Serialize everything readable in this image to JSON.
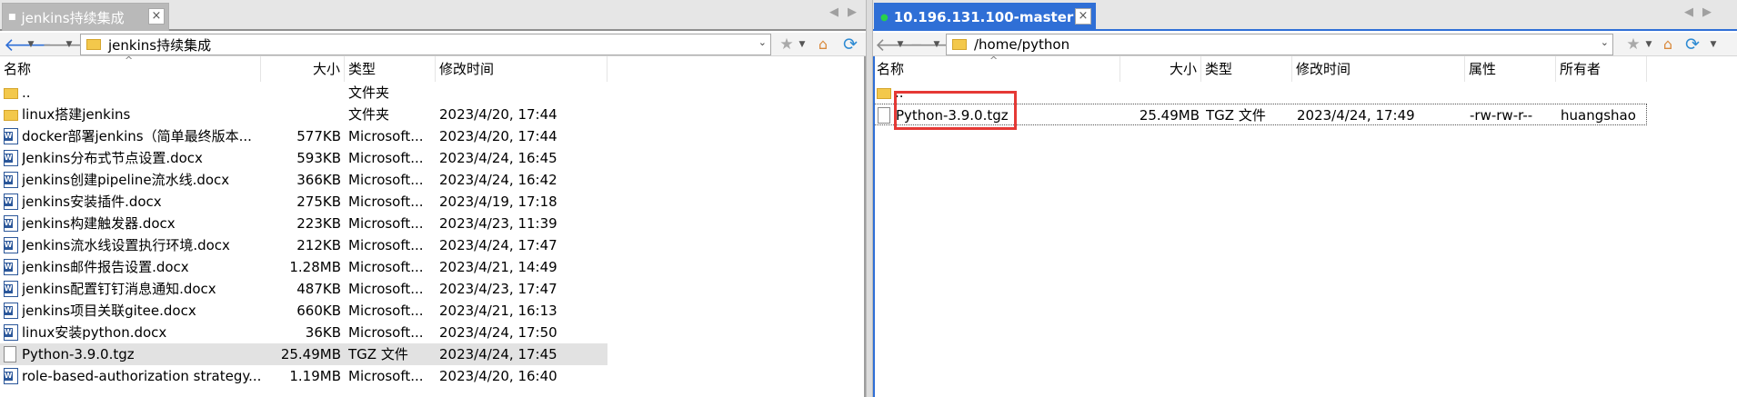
{
  "left": {
    "tab_title": "jenkins持续集成",
    "tab_state_icon": "square-icon",
    "close_glyph": "×",
    "path": "jenkins持续集成",
    "columns": {
      "name": "名称",
      "size": "大小",
      "type": "类型",
      "mtime": "修改时间"
    },
    "files": [
      {
        "icon": "folder",
        "name": "..",
        "size": "",
        "type": "文件夹",
        "mtime": ""
      },
      {
        "icon": "folder",
        "name": "linux搭建jenkins",
        "size": "",
        "type": "文件夹",
        "mtime": "2023/4/20, 17:44"
      },
      {
        "icon": "doc",
        "name": "docker部署jenkins（简单最终版本...",
        "size": "577KB",
        "type": "Microsoft...",
        "mtime": "2023/4/20, 17:44"
      },
      {
        "icon": "doc",
        "name": "Jenkins分布式节点设置.docx",
        "size": "593KB",
        "type": "Microsoft...",
        "mtime": "2023/4/24, 16:45"
      },
      {
        "icon": "doc",
        "name": "jenkins创建pipeline流水线.docx",
        "size": "366KB",
        "type": "Microsoft...",
        "mtime": "2023/4/24, 16:42"
      },
      {
        "icon": "doc",
        "name": "jenkins安装插件.docx",
        "size": "275KB",
        "type": "Microsoft...",
        "mtime": "2023/4/19, 17:18"
      },
      {
        "icon": "doc",
        "name": "jenkins构建触发器.docx",
        "size": "223KB",
        "type": "Microsoft...",
        "mtime": "2023/4/23, 11:39"
      },
      {
        "icon": "doc",
        "name": "Jenkins流水线设置执行环境.docx",
        "size": "212KB",
        "type": "Microsoft...",
        "mtime": "2023/4/24, 17:47"
      },
      {
        "icon": "doc",
        "name": "jenkins邮件报告设置.docx",
        "size": "1.28MB",
        "type": "Microsoft...",
        "mtime": "2023/4/21, 14:49"
      },
      {
        "icon": "doc",
        "name": "jenkins配置钉钉消息通知.docx",
        "size": "487KB",
        "type": "Microsoft...",
        "mtime": "2023/4/23, 17:47"
      },
      {
        "icon": "doc",
        "name": "jenkins项目关联gitee.docx",
        "size": "660KB",
        "type": "Microsoft...",
        "mtime": "2023/4/21, 16:13"
      },
      {
        "icon": "doc",
        "name": "linux安装python.docx",
        "size": "36KB",
        "type": "Microsoft...",
        "mtime": "2023/4/24, 17:50"
      },
      {
        "icon": "file",
        "name": "Python-3.9.0.tgz",
        "size": "25.49MB",
        "type": "TGZ 文件",
        "mtime": "2023/4/24, 17:45",
        "highlighted": true
      },
      {
        "icon": "doc",
        "name": "role-based-authorization strategy...",
        "size": "1.19MB",
        "type": "Microsoft...",
        "mtime": "2023/4/20, 16:40"
      }
    ]
  },
  "right": {
    "tab_title": "10.196.131.100-master",
    "tab_state_icon": "connected-icon",
    "close_glyph": "×",
    "path": "/home/python",
    "columns": {
      "name": "名称",
      "size": "大小",
      "type": "类型",
      "mtime": "修改时间",
      "attr": "属性",
      "owner": "所有者"
    },
    "files": [
      {
        "icon": "folder",
        "name": "..",
        "size": "",
        "type": "",
        "mtime": "",
        "attr": "",
        "owner": ""
      },
      {
        "icon": "file",
        "name": "Python-3.9.0.tgz",
        "size": "25.49MB",
        "type": "TGZ 文件",
        "mtime": "2023/4/24, 17:49",
        "attr": "-rw-rw-r--",
        "owner": "huangshao",
        "selected": true
      }
    ]
  },
  "glyphs": {
    "back": "🡐",
    "forward": "🡒",
    "drop": "▼",
    "caret_up": "^",
    "scroll_left": "◀",
    "scroll_right": "▶",
    "star": "★",
    "home": "⌂",
    "refresh": "⟳",
    "combo": "⌄"
  },
  "colors": {
    "accent": "#2f6fd6",
    "highlight": "#e53935",
    "folder": "#f3c84b"
  }
}
